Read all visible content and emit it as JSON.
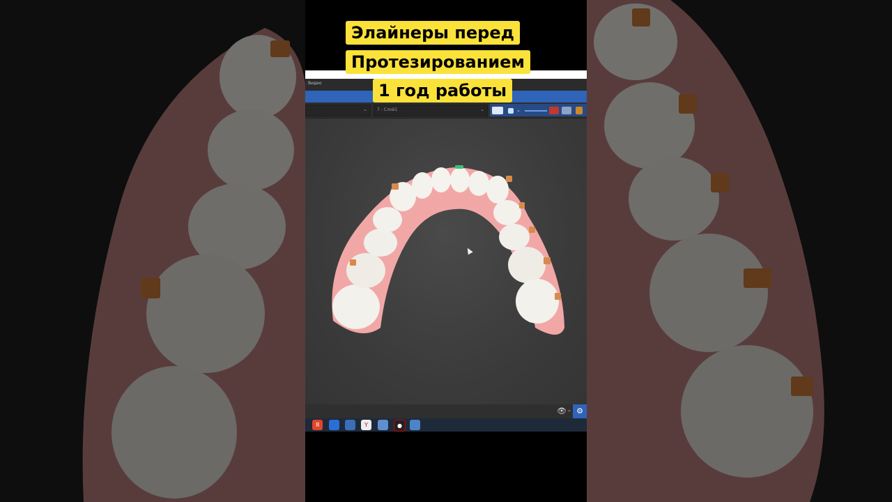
{
  "caption": {
    "line1": "Элайнеры перед",
    "line2": "Протезированием",
    "line3": "1 год работы"
  },
  "app": {
    "title": "Видео",
    "dropdown_left": "",
    "dropdown_layer": "7 - Слой1"
  },
  "taskbar": {
    "icons": [
      "yandex-icon",
      "paint-icon",
      "monitor-icon",
      "yandex-browser-icon",
      "app-icon",
      "record-icon",
      "active-app-icon"
    ]
  },
  "colors": {
    "caption_bg": "#fbe23a",
    "accent_blue": "#2f64b8",
    "gum": "#f2a7a7",
    "tooth": "#f3f1ec",
    "attachment": "#d88a4a"
  }
}
